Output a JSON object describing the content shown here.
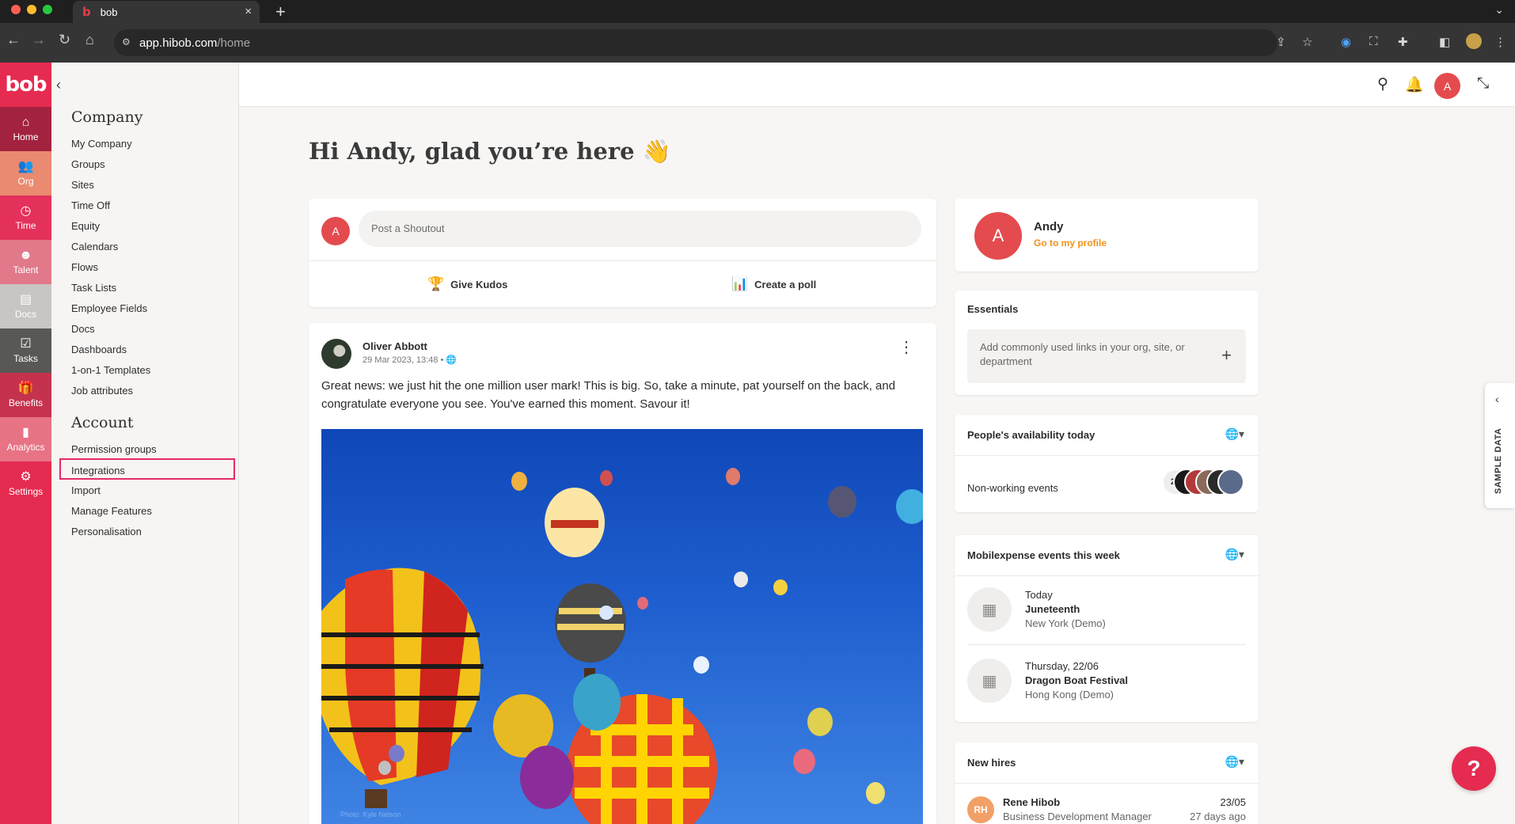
{
  "browser": {
    "tab_title": "bob",
    "tab_favicon": "b",
    "url_host": "app.hibob.com",
    "url_path": "/home",
    "tab_close": "×",
    "new_tab": "+"
  },
  "rail": {
    "logo": "bob",
    "items": [
      {
        "label": "Home",
        "icon": "home-icon",
        "glyph": "⌂"
      },
      {
        "label": "Org",
        "icon": "people-icon",
        "glyph": "👥"
      },
      {
        "label": "Time",
        "icon": "clock-icon",
        "glyph": "◷"
      },
      {
        "label": "Talent",
        "icon": "talent-icon",
        "glyph": "☻"
      },
      {
        "label": "Docs",
        "icon": "document-icon",
        "glyph": "▤"
      },
      {
        "label": "Tasks",
        "icon": "checkbox-icon",
        "glyph": "☑"
      },
      {
        "label": "Benefits",
        "icon": "gift-icon",
        "glyph": "🎁"
      },
      {
        "label": "Analytics",
        "icon": "bar-chart-icon",
        "glyph": "▮"
      },
      {
        "label": "Settings",
        "icon": "gear-icon",
        "glyph": "⚙"
      }
    ]
  },
  "sidepanel": {
    "company_title": "Company",
    "company_items": [
      "My Company",
      "Groups",
      "Sites",
      "Time Off",
      "Equity",
      "Calendars",
      "Flows",
      "Task Lists",
      "Employee Fields",
      "Docs",
      "Dashboards",
      "1-on-1 Templates",
      "Job attributes"
    ],
    "account_title": "Account",
    "account_items": [
      "Permission groups",
      "Integrations",
      "Import",
      "Manage Features",
      "Personalisation"
    ]
  },
  "appbar": {
    "avatar_initial": "A"
  },
  "greeting": "Hi Andy, glad you’re here 👋",
  "shoutout": {
    "avatar_initial": "A",
    "placeholder": "Post a Shoutout",
    "kudos_label": "Give Kudos",
    "poll_label": "Create a poll"
  },
  "post": {
    "author": "Oliver Abbott",
    "meta": "29 Mar 2023, 13:48 •",
    "body": "Great news: we just hit the one million user mark! This is big. So, take a minute, pat yourself on the back, and congratulate everyone you see. You've earned this moment. Savour it!",
    "photo_credit": "Photo: Kyle Nelson"
  },
  "profile": {
    "initial": "A",
    "name": "Andy",
    "link": "Go to my profile"
  },
  "essentials": {
    "title": "Essentials",
    "hint": "Add commonly used links in your org, site, or department",
    "add": "+"
  },
  "availability": {
    "title": "People's availability today",
    "row_label": "Non-working events",
    "count": "22"
  },
  "events": {
    "title": "Mobilexpense events this week",
    "items": [
      {
        "when": "Today",
        "name": "Juneteenth",
        "place": "New York (Demo)"
      },
      {
        "when": "Thursday, 22/06",
        "name": "Dragon Boat Festival",
        "place": "Hong Kong (Demo)"
      }
    ]
  },
  "new_hires": {
    "title": "New hires",
    "items": [
      {
        "initials": "RH",
        "name": "Rene Hibob",
        "role": "Business Development Manager",
        "date": "23/05",
        "ago": "27 days ago"
      }
    ]
  },
  "sample_tab": "SAMPLE DATA",
  "help": "?"
}
